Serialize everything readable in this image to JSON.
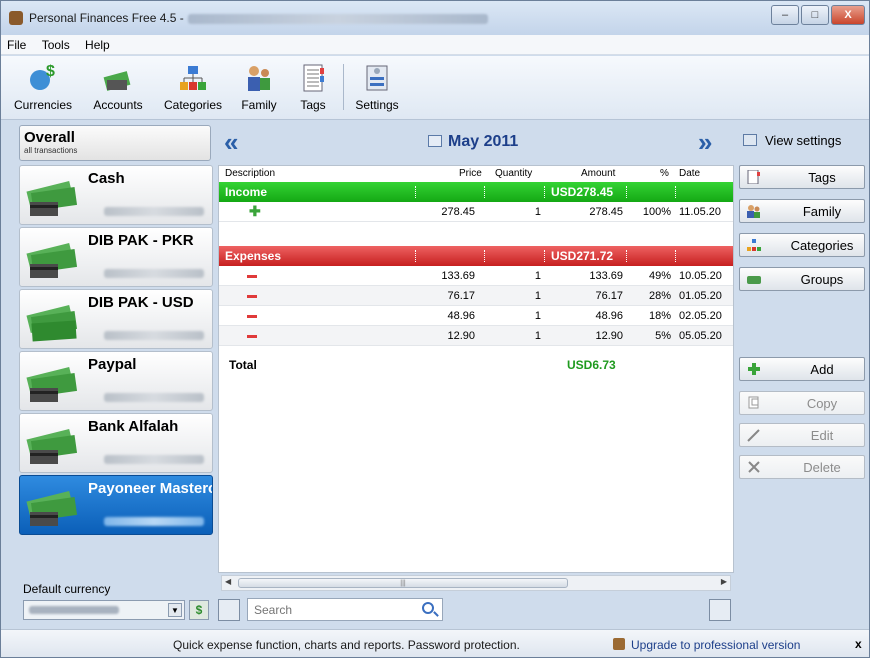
{
  "window": {
    "title": "Personal Finances Free 4.5 -",
    "minimize": "–",
    "maximize": "□",
    "close": "X"
  },
  "menu": [
    "File",
    "Tools",
    "Help"
  ],
  "toolbar": [
    {
      "label": "Currencies",
      "icon": "currencies-icon"
    },
    {
      "label": "Accounts",
      "icon": "accounts-icon"
    },
    {
      "label": "Categories",
      "icon": "categories-icon"
    },
    {
      "label": "Family",
      "icon": "family-icon"
    },
    {
      "label": "Tags",
      "icon": "tags-icon"
    },
    {
      "label": "Settings",
      "icon": "settings-icon"
    }
  ],
  "overall": {
    "title": "Overall",
    "subtitle": "all transactions"
  },
  "accounts": [
    {
      "name": "Cash"
    },
    {
      "name": "DIB PAK - PKR"
    },
    {
      "name": "DIB PAK - USD"
    },
    {
      "name": "Paypal"
    },
    {
      "name": "Bank Alfalah"
    },
    {
      "name": "Payoneer Mastercard",
      "selected": true
    }
  ],
  "default_currency": {
    "label": "Default currency"
  },
  "period": {
    "month": "May 2011",
    "prev": "«",
    "next": "»"
  },
  "table": {
    "headers": {
      "description": "Description",
      "price": "Price",
      "quantity": "Quantity",
      "amount": "Amount",
      "percent": "%",
      "date": "Date"
    },
    "income": {
      "label": "Income",
      "total": "USD278.45",
      "rows": [
        {
          "price": "278.45",
          "quantity": "1",
          "amount": "278.45",
          "percent": "100%",
          "date": "11.05.20"
        }
      ]
    },
    "expenses": {
      "label": "Expenses",
      "total": "USD271.72",
      "rows": [
        {
          "price": "133.69",
          "quantity": "1",
          "amount": "133.69",
          "percent": "49%",
          "date": "10.05.20"
        },
        {
          "price": "76.17",
          "quantity": "1",
          "amount": "76.17",
          "percent": "28%",
          "date": "01.05.20"
        },
        {
          "price": "48.96",
          "quantity": "1",
          "amount": "48.96",
          "percent": "18%",
          "date": "02.05.20"
        },
        {
          "price": "12.90",
          "quantity": "1",
          "amount": "12.90",
          "percent": "5%",
          "date": "05.05.20"
        }
      ]
    },
    "total": {
      "label": "Total",
      "value": "USD6.73"
    }
  },
  "search": {
    "placeholder": "Search"
  },
  "right_panel": {
    "view_settings": "View settings",
    "filters": [
      "Tags",
      "Family",
      "Categories",
      "Groups"
    ],
    "actions": {
      "add": "Add",
      "copy": "Copy",
      "edit": "Edit",
      "delete": "Delete"
    }
  },
  "status": {
    "message": "Quick expense function, charts and reports. Password protection.",
    "upgrade": "Upgrade to professional version",
    "close": "x"
  },
  "colors": {
    "income": "#1cb31c",
    "expenses": "#d22b2b",
    "selected_account": "#1a73cf",
    "total": "#1f9a1f"
  }
}
